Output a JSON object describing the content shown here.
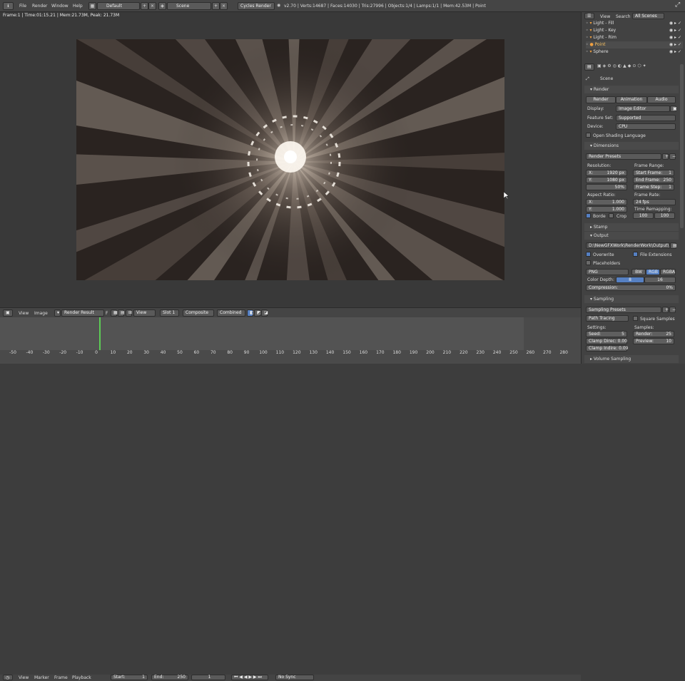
{
  "topbar": {
    "menus": [
      "File",
      "Render",
      "Window",
      "Help"
    ],
    "layout": "Default",
    "scene": "Scene",
    "engine": "Cycles Render",
    "stats": "v2.70 | Verts:14687 | Faces:14030 | Tris:27996 | Objects:1/4 | Lamps:1/1 | Mem:42.53M | Point"
  },
  "viewport": {
    "frame_info": "Frame:1 | Time:01:15.21 | Mem:21.73M, Peak: 21.73M"
  },
  "image_header": {
    "view": "View",
    "image": "Image",
    "render_result": "Render Result",
    "f": "F",
    "view2": "View",
    "slot": "Slot 1",
    "composite": "Composite",
    "combined": "Combined"
  },
  "timeline": {
    "ticks": [
      "-50",
      "-40",
      "-30",
      "-20",
      "-10",
      "0",
      "10",
      "20",
      "30",
      "40",
      "50",
      "60",
      "70",
      "80",
      "90",
      "100",
      "110",
      "120",
      "130",
      "140",
      "150",
      "160",
      "170",
      "180",
      "190",
      "200",
      "210",
      "220",
      "230",
      "240",
      "250",
      "260",
      "270",
      "280"
    ],
    "menu": [
      "View",
      "Marker",
      "Frame",
      "Playback"
    ],
    "start": "Start:",
    "start_val": "1",
    "end": "End:",
    "end_val": "250",
    "current": "1",
    "sync": "No Sync"
  },
  "outliner": {
    "view": "View",
    "search": "Search",
    "scenes": "All Scenes",
    "items": [
      "Light - Fill",
      "Light - Key",
      "Light - Rim",
      "Point",
      "Sphere"
    ]
  },
  "props": {
    "scene": "Scene",
    "render_panel": "Render",
    "render_btn": "Render",
    "animation_btn": "Animation",
    "audio_btn": "Audio",
    "display_lbl": "Display:",
    "display_val": "Image Editor",
    "feature_lbl": "Feature Set:",
    "feature_val": "Supported",
    "device_lbl": "Device:",
    "device_val": "CPU",
    "osl": "Open Shading Language",
    "dimensions_panel": "Dimensions",
    "presets": "Render Presets",
    "resolution": "Resolution:",
    "frame_range": "Frame Range:",
    "res_x": "X:",
    "res_x_val": "1920 px",
    "res_y": "Y:",
    "res_y_val": "1080 px",
    "res_pct": "50%",
    "start_frame": "Start Frame:",
    "start_frame_val": "1",
    "end_frame": "End Frame:",
    "end_frame_val": "250",
    "frame_step": "Frame Step:",
    "frame_step_val": "1",
    "aspect": "Aspect Ratio:",
    "frame_rate": "Frame Rate:",
    "asp_x": "X:",
    "asp_x_val": "1.000",
    "asp_y": "Y:",
    "asp_y_val": "1.000",
    "fps": "24 fps",
    "time_remap": "Time Remapping:",
    "remap_a": "100",
    "remap_b": "100",
    "border": "Borde",
    "crop": "Crop",
    "stamp_panel": "Stamp",
    "output_panel": "Output",
    "output_path": "D:\\NewGFXWork\\RenderWork\\Output\\",
    "overwrite": "Overwrite",
    "file_ext": "File Extensions",
    "placeholders": "Placeholders",
    "format": "PNG",
    "bw": "BW",
    "rgb": "RGB",
    "rgba": "RGBA",
    "color_depth": "Color Depth:",
    "depth8": "8",
    "depth16": "16",
    "compression": "Compression:",
    "compression_val": "0%",
    "sampling_panel": "Sampling",
    "sampling_presets": "Sampling Presets",
    "path_tracing": "Path Tracing",
    "square_samples": "Square Samples",
    "settings": "Settings:",
    "samples": "Samples:",
    "seed": "Seed:",
    "seed_val": "5",
    "clamp_direct": "Clamp Direc: 0.00",
    "clamp_indirect": "Clamp Indire: 0.09",
    "render_samples": "Render:",
    "render_samples_val": "25",
    "preview": "Preview:",
    "preview_val": "10",
    "volume_panel": "Volume Sampling"
  }
}
